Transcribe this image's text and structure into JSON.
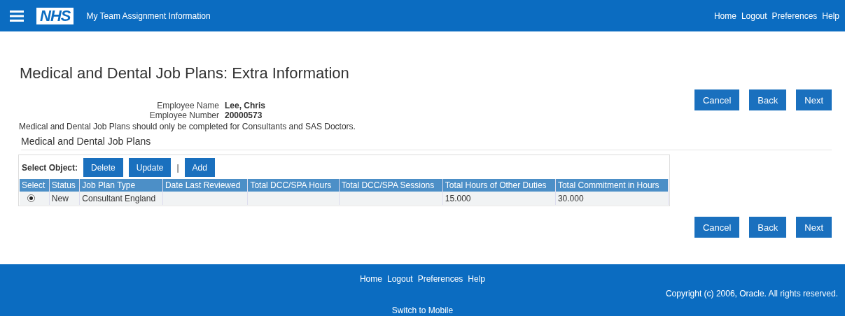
{
  "header": {
    "logo": "NHS",
    "app_title": "My Team Assignment Information",
    "links": [
      "Home",
      "Logout",
      "Preferences",
      "Help"
    ]
  },
  "page": {
    "title": "Medical and Dental Job Plans: Extra Information",
    "top_buttons": [
      "Cancel",
      "Back",
      "Next"
    ],
    "employee": [
      {
        "label": "Employee Name",
        "value": "Lee, Chris"
      },
      {
        "label": "Employee Number",
        "value": "20000573"
      }
    ],
    "note": "Medical and Dental Job Plans should only be completed for Consultants and SAS Doctors.",
    "section_title": "Medical and Dental Job Plans",
    "table": {
      "select_label": "Select Object:",
      "actions": [
        {
          "kind": "button",
          "label": "Delete"
        },
        {
          "kind": "button",
          "label": "Update"
        },
        {
          "kind": "separator",
          "label": "|"
        },
        {
          "kind": "button",
          "label": "Add"
        }
      ],
      "columns": [
        "Select",
        "Status",
        "Job Plan Type",
        "Date Last Reviewed",
        "Total DCC/SPA Hours",
        "Total DCC/SPA Sessions",
        "Total Hours of Other Duties",
        "Total Commitment in Hours"
      ],
      "rows": [
        {
          "selected": true,
          "cells": [
            "",
            "New",
            "Consultant England",
            "",
            "",
            "",
            "15.000",
            "30.000"
          ]
        }
      ]
    },
    "bottom_buttons": [
      "Cancel",
      "Back",
      "Next"
    ]
  },
  "footer": {
    "links": [
      "Home",
      "Logout",
      "Preferences",
      "Help"
    ],
    "copyright": "Copyright (c) 2006, Oracle. All rights reserved.",
    "mobile_link": "Switch to Mobile"
  }
}
